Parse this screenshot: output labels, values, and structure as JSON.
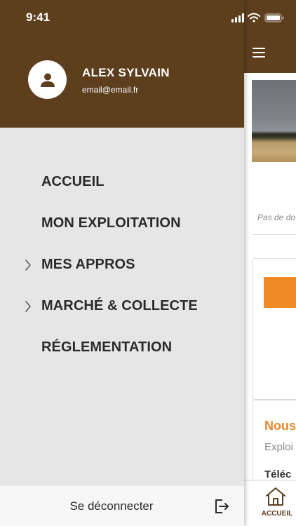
{
  "status_bar": {
    "time": "9:41"
  },
  "drawer": {
    "user": {
      "name": "ALEX SYLVAIN",
      "email": "email@email.fr"
    },
    "menu": [
      {
        "label": "ACCUEIL",
        "has_submenu": false
      },
      {
        "label": "MON EXPLOITATION",
        "has_submenu": false
      },
      {
        "label": "MES APPROS",
        "has_submenu": true
      },
      {
        "label": "MARCHÉ & COLLECTE",
        "has_submenu": true
      },
      {
        "label": "RÉGLEMENTATION",
        "has_submenu": false
      }
    ],
    "logout_label": "Se déconnecter"
  },
  "page": {
    "empty_text": "Pas de do",
    "card_title": "Nous",
    "card_subtitle": "Exploi",
    "card_download": "Téléc",
    "tabbar": {
      "home_label": "ACCUEIL"
    }
  },
  "colors": {
    "brand_brown": "#5d3f1e",
    "accent_orange": "#ef8a25",
    "drawer_bg": "#e6e6e6"
  }
}
